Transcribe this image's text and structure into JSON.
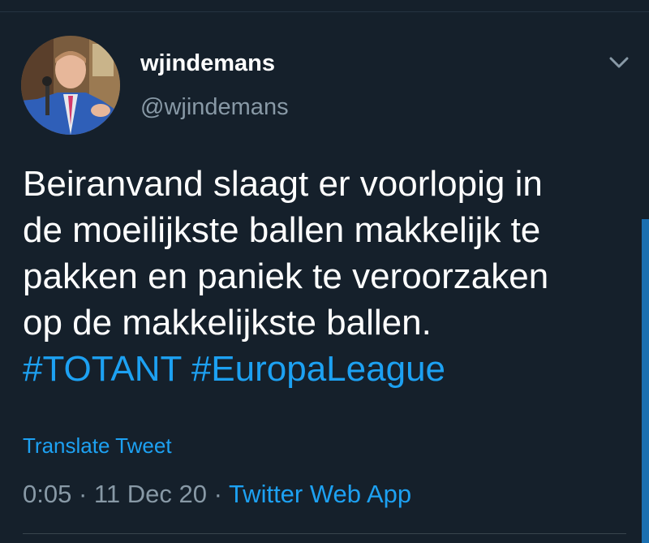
{
  "tweet": {
    "display_name": "wjindemans",
    "handle": "@wjindemans",
    "text_lines": [
      "Beiranvand slaagt er voorlopig in",
      "de moeilijkste ballen makkelijk te",
      "pakken en paniek te veroorzaken",
      "op de makkelijkste ballen."
    ],
    "hashtags": [
      "#TOTANT",
      "#EuropaLeague"
    ],
    "translate_label": "Translate Tweet",
    "time": "0:05",
    "separator": "·",
    "date": "11 Dec 20",
    "source": "Twitter Web App"
  },
  "icons": {
    "menu": "chevron-down-icon",
    "avatar": "profile-photo"
  },
  "colors": {
    "background": "#15202b",
    "text": "#ffffff",
    "secondary": "#8899a6",
    "link": "#1da1f2"
  }
}
